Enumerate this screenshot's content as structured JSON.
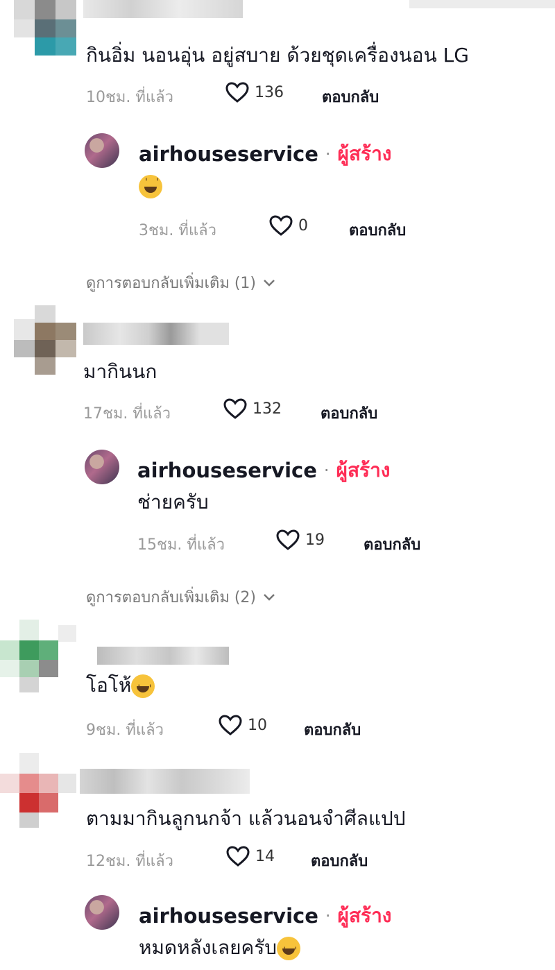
{
  "comments": [
    {
      "text": "กินอิ่ม นอนอุ่น อยู่สบาย ด้วยชุดเครื่องนอน LG",
      "time": "10ชม. ที่แล้ว",
      "likes": "136",
      "reply_label": "ตอบกลับ",
      "creator_reply": {
        "username": "airhouseservice",
        "separator": "·",
        "badge": "ผู้สร้าง",
        "emoji": "sweat-smile-emoji",
        "text": "",
        "time": "3ชม. ที่แล้ว",
        "likes": "0",
        "reply_label": "ตอบกลับ"
      },
      "view_more": "ดูการตอบกลับเพิ่มเติม (1)"
    },
    {
      "text": "มากินนก",
      "time": "17ชม. ที่แล้ว",
      "likes": "132",
      "reply_label": "ตอบกลับ",
      "creator_reply": {
        "username": "airhouseservice",
        "separator": "·",
        "badge": "ผู้สร้าง",
        "text": "ช่ายครับ",
        "time": "15ชม. ที่แล้ว",
        "likes": "19",
        "reply_label": "ตอบกลับ"
      },
      "view_more": "ดูการตอบกลับเพิ่มเติม (2)"
    },
    {
      "text": "โอโห้",
      "emoji": "laughing-tears-emoji",
      "time": "9ชม. ที่แล้ว",
      "likes": "10",
      "reply_label": "ตอบกลับ"
    },
    {
      "text": "ตามมากินลูกนกจ้า แล้วนอนจำศีลแปป",
      "time": "12ชม. ที่แล้ว",
      "likes": "14",
      "reply_label": "ตอบกลับ",
      "creator_reply": {
        "username": "airhouseservice",
        "separator": "·",
        "badge": "ผู้สร้าง",
        "text": "หมดหลังเลยครับ",
        "emoji": "grinning-emoji"
      }
    }
  ],
  "colors": {
    "creator_badge": "#fe2c55",
    "meta": "#9a9a9a",
    "text": "#161823"
  },
  "icons": {
    "like": "heart-outline-icon",
    "expand": "chevron-down-icon"
  }
}
